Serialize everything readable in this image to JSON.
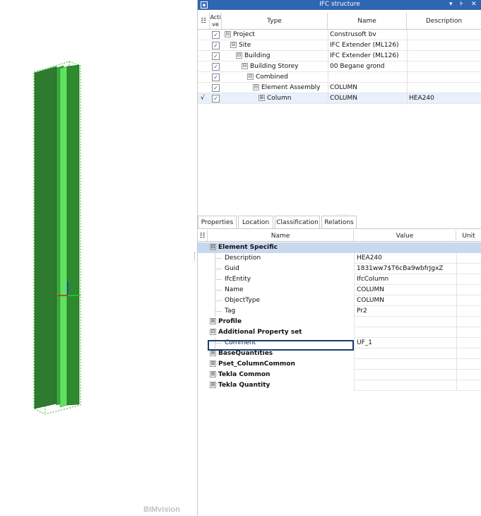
{
  "app": {
    "brand": "BIMvision"
  },
  "viewport": {
    "model": "steel-column-hea240",
    "colors": {
      "steel_dark": "#2f7d2f",
      "steel_light": "#57e057",
      "selection": "#1fbf1f"
    }
  },
  "ifc_panel": {
    "title": "IFC structure",
    "columns": {
      "active": "Acti ve",
      "type": "Type",
      "name": "Name",
      "description": "Description"
    },
    "rows": [
      {
        "mark": "",
        "active": "✓",
        "expander": "⊟",
        "type": "Project",
        "name": "Construsoft bv",
        "description": ""
      },
      {
        "mark": "",
        "active": "✓",
        "expander": "⊟",
        "type": "Site",
        "name": "IFC Extender (ML126)",
        "description": ""
      },
      {
        "mark": "",
        "active": "✓",
        "expander": "⊟",
        "type": "Building",
        "name": "IFC Extender (ML126)",
        "description": ""
      },
      {
        "mark": "",
        "active": "✓",
        "expander": "⊟",
        "type": "Building Storey",
        "name": "00 Begane grond",
        "description": ""
      },
      {
        "mark": "",
        "active": "✓",
        "expander": "⊟",
        "type": "Combined",
        "name": "",
        "description": ""
      },
      {
        "mark": "",
        "active": "✓",
        "expander": "⊟",
        "type": "Element Assembly",
        "name": "COLUMN",
        "description": ""
      },
      {
        "mark": "√",
        "active": "✓",
        "expander": "⊞",
        "type": "Column",
        "name": "COLUMN",
        "description": "HEA240"
      }
    ],
    "splitter": "....."
  },
  "props_panel": {
    "tabs": [
      "Properties",
      "Location",
      "Classification",
      "Relations"
    ],
    "columns": {
      "name": "Name",
      "value": "Value",
      "unit": "Unit"
    },
    "rows": [
      {
        "kind": "group",
        "expander": "⊟",
        "name": "Element Specific",
        "value": "",
        "highlight": true
      },
      {
        "kind": "item",
        "name": "Description",
        "value": "HEA240"
      },
      {
        "kind": "item",
        "name": "Guid",
        "value": "1831ww7$T6cBa9wbfrJgxZ"
      },
      {
        "kind": "item",
        "name": "IfcEntity",
        "value": "IfcColumn"
      },
      {
        "kind": "item",
        "name": "Name",
        "value": "COLUMN"
      },
      {
        "kind": "item",
        "name": "ObjectType",
        "value": "COLUMN"
      },
      {
        "kind": "item",
        "name": "Tag",
        "value": "Pr2"
      },
      {
        "kind": "group",
        "expander": "⊞",
        "name": "Profile",
        "value": ""
      },
      {
        "kind": "group",
        "expander": "⊟",
        "name": "Additional Property set",
        "value": ""
      },
      {
        "kind": "item",
        "name": "Comment",
        "value": "UF_1",
        "editing": true
      },
      {
        "kind": "group",
        "expander": "⊞",
        "name": "BaseQuantities",
        "value": ""
      },
      {
        "kind": "group",
        "expander": "⊞",
        "name": "Pset_ColumnCommon",
        "value": ""
      },
      {
        "kind": "group",
        "expander": "⊞",
        "name": "Tekla Common",
        "value": ""
      },
      {
        "kind": "group",
        "expander": "⊞",
        "name": "Tekla Quantity",
        "value": ""
      }
    ]
  }
}
